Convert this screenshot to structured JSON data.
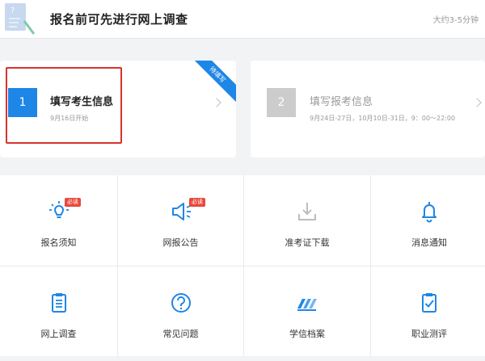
{
  "survey": {
    "title": "报名前可先进行网上调查",
    "time": "大约3-5分钟",
    "icon": "questionnaire-icon"
  },
  "steps": [
    {
      "number": "1",
      "title": "填写考生信息",
      "subtitle": "9月16日开始",
      "ribbon": "待填写",
      "active": true
    },
    {
      "number": "2",
      "title": "填写报考信息",
      "subtitle": "9月24日-27日，10月10日-31日，9：00～22:00",
      "active": false
    }
  ],
  "grid": {
    "items": [
      {
        "label": "报名须知",
        "icon": "bulb-icon",
        "badge": "必读"
      },
      {
        "label": "网报公告",
        "icon": "megaphone-icon",
        "badge": "必读"
      },
      {
        "label": "准考证下载",
        "icon": "download-icon"
      },
      {
        "label": "消息通知",
        "icon": "bell-icon"
      },
      {
        "label": "网上调查",
        "icon": "clipboard-icon"
      },
      {
        "label": "常见问题",
        "icon": "question-icon"
      },
      {
        "label": "学信档案",
        "icon": "archive-icon"
      },
      {
        "label": "职业测评",
        "icon": "checklist-icon"
      }
    ]
  },
  "colors": {
    "accent": "#1e86e6",
    "badge": "#e8483b",
    "highlight": "#d9322c",
    "disabled": "#cccccc"
  }
}
